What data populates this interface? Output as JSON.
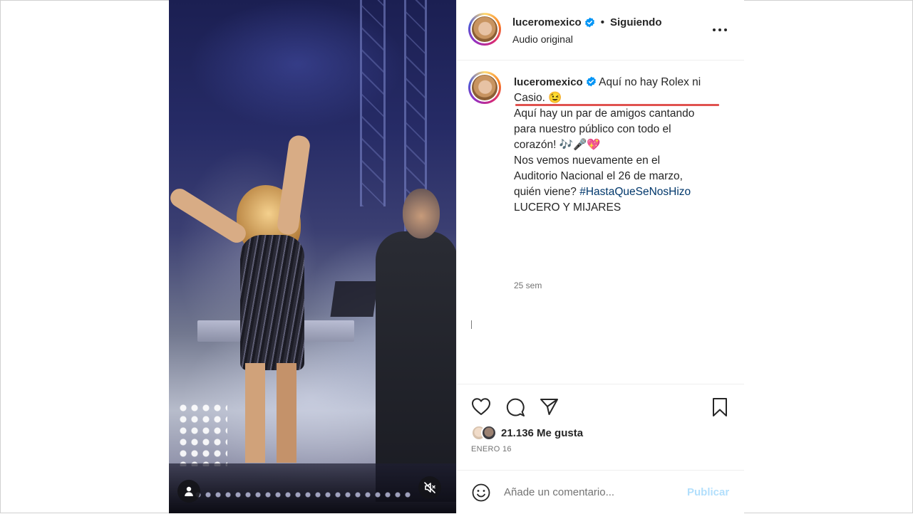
{
  "account": {
    "username": "luceromexico",
    "verified": true,
    "follow_status": "Siguiendo",
    "separator": "•",
    "audio": "Audio original"
  },
  "caption": {
    "username": "luceromexico",
    "lines": [
      "Aquí no hay Rolex ni",
      "Casio. 😉",
      "Aquí hay un par de amigos cantando",
      "para nuestro público con todo el",
      "corazón! 🎶🎤💖",
      "Nos vemos nuevamente en el",
      "Auditorio Nacional el 26 de marzo,",
      "quién viene?"
    ],
    "hashtag": "#HastaQueSeNosHizo",
    "signature": "LUCERO Y MIJARES",
    "age": "25 sem"
  },
  "engagement": {
    "likes": "21.136 Me gusta",
    "date": "ENERO 16"
  },
  "comment_box": {
    "placeholder": "Añade un comentario...",
    "post_label": "Publicar"
  },
  "icons": {
    "header": [
      "verified-badge-icon",
      "more-options-icon"
    ],
    "actions": [
      "heart-icon",
      "comment-icon",
      "share-icon",
      "bookmark-icon"
    ],
    "video": [
      "user-tag-icon",
      "mute-icon"
    ],
    "comment": [
      "emoji-icon"
    ]
  },
  "colors": {
    "verified": "#0095f6",
    "hashtag": "#00376b",
    "muted_text": "#737373",
    "post_button": "#b2dffc",
    "annotation_underline": "#e0524f"
  }
}
